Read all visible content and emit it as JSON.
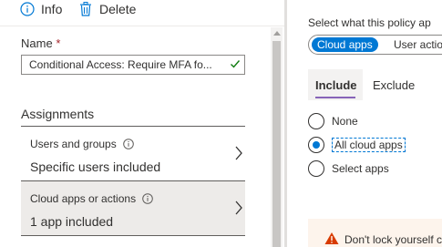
{
  "toolbar": {
    "info_label": "Info",
    "delete_label": "Delete"
  },
  "form": {
    "name_label": "Name",
    "required_mark": "*",
    "name_value": "Conditional Access: Require MFA fo..."
  },
  "assignments": {
    "title": "Assignments",
    "items": [
      {
        "title": "Users and groups",
        "value": "Specific users included"
      },
      {
        "title": "Cloud apps or actions",
        "value": "1 app included"
      }
    ]
  },
  "right_panel": {
    "select_label": "Select what this policy ap",
    "toggle_options": [
      "Cloud apps",
      "User actio"
    ],
    "tabs": [
      "Include",
      "Exclude"
    ],
    "radio_options": [
      "None",
      "All cloud apps",
      "Select apps"
    ],
    "selected_option": "All cloud apps",
    "warning_text": "Don't lock yourself c"
  },
  "colors": {
    "accent": "#0078d4",
    "tab_underline": "#8764b8",
    "selected_row_bg": "#edebe9",
    "required": "#a4262c",
    "warning_icon": "#d83b01"
  },
  "icons": [
    "info-icon",
    "trash-icon",
    "checkmark-icon",
    "chevron-right-icon",
    "warning-icon"
  ]
}
